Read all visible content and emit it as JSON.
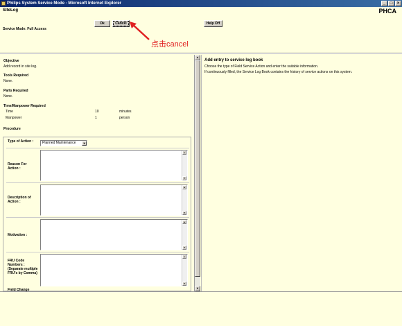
{
  "window": {
    "title": "Philips System Service Mode - Microsoft Internet Explorer",
    "controls": {
      "minimize": "_",
      "maximize": "□",
      "close": "×"
    }
  },
  "header": {
    "page": "SiteLog",
    "brand": "PHCA",
    "service_mode": "Service Mode: Full Access"
  },
  "toolbar": {
    "ok_label": "Ok",
    "cancel_label": "Cancel",
    "help_label": "Help Off"
  },
  "annotation": {
    "text": "点击cancel",
    "color": "#e02020"
  },
  "left": {
    "objective_h": "Objective",
    "objective": "Add record in site log.",
    "tools_h": "Tools Required",
    "tools": "None.",
    "parts_h": "Parts Required",
    "parts": "None.",
    "time_h": "Time/Manpower Required",
    "time_label": "Time",
    "time_value": "10",
    "time_unit": "minutes",
    "manpower_label": "Manpower",
    "manpower_value": "1",
    "manpower_unit": "person",
    "procedure_h": "Procedure"
  },
  "form": {
    "type_label": "Type of Action :",
    "type_value": "Planned Maintenance",
    "reason_label": "Reason For Action :",
    "description_label": "Description of Action :",
    "motivation_label": "Motivation :",
    "fru_label": "FRU Code Numbers : (Separate multiple FRU's by Comma)",
    "field_change_label": "Field Change"
  },
  "right": {
    "heading": "Add entry to service log book",
    "line1": "Choose the type of Field Service Action and enter the suitable information.",
    "line2": "If continuously filled, the Service Log Book contains the history of service actions on this system."
  }
}
